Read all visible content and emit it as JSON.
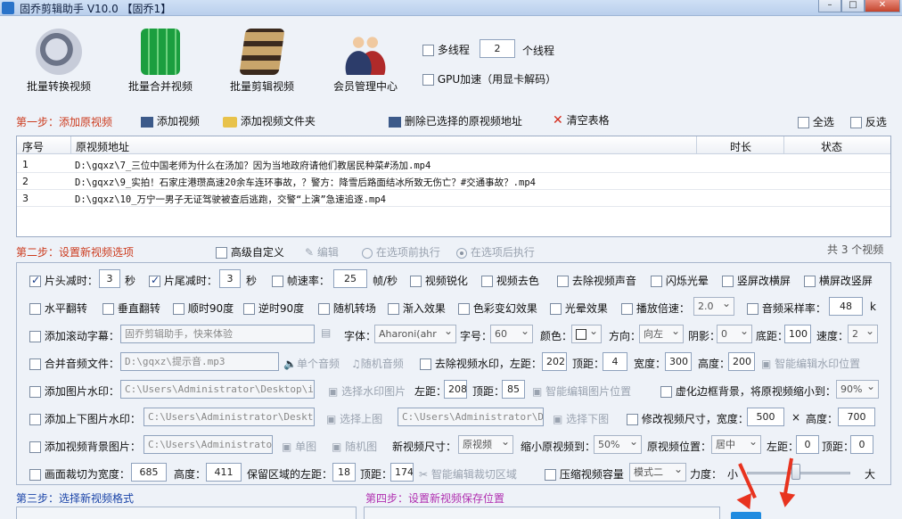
{
  "window": {
    "title": "固乔剪辑助手 V10.0 【固乔1】"
  },
  "toolbar": {
    "batch_convert": "批量转换视频",
    "batch_merge": "批量合并视频",
    "batch_edit": "批量剪辑视频",
    "member_center": "会员管理中心"
  },
  "threads": {
    "multi_label": "多线程",
    "count": "2",
    "unit": "个线程",
    "gpu_label": "GPU加速（用显卡解码）"
  },
  "step1": {
    "label": "第一步：添加原视频",
    "add_video": "添加视频",
    "add_folder": "添加视频文件夹",
    "delete_selected": "删除已选择的原视频地址",
    "clear_table": "清空表格",
    "select_all": "全选",
    "invert": "反选"
  },
  "table": {
    "columns": [
      "序号",
      "原视频地址",
      "时长",
      "状态"
    ],
    "rows": [
      {
        "idx": "1",
        "path": "D:\\gqxz\\7_三位中国老师为什么在汤加？因为当地政府请他们教居民种菜#汤加.mp4"
      },
      {
        "idx": "2",
        "path": "D:\\gqxz\\9_实拍！石家庄港瓒高速20余车连环事故，？警方：降雪后路面结冰所致无伤亡？#交通事故？.mp4"
      },
      {
        "idx": "3",
        "path": "D:\\gqxz\\10_万宁一男子无证驾驶被查后逃跑，交警“上演”急速追逐.mp4"
      }
    ],
    "count_text": "共 3 个视频"
  },
  "step2": {
    "label": "第二步：设置新视频选项",
    "advanced": "高级自定义",
    "edit": "编辑",
    "before_opt": "在选项前执行",
    "after_opt": "在选项后执行"
  },
  "opts": {
    "head_cut": "片头减时：",
    "head_val": "3",
    "sec": "秒",
    "tail_cut": "片尾减时：",
    "tail_val": "3",
    "fps": "帧速率：",
    "fps_val": "25",
    "fps_unit": "帧/秒",
    "sharpen": "视频锐化",
    "decolor": "视频去色",
    "remove_audio": "去除视频声音",
    "flash": "闪烁光晕",
    "v2h": "竖屏改横屏",
    "h2v": "横屏改竖屏",
    "hflip": "水平翻转",
    "vflip": "垂直翻转",
    "rot90": "顺时90度",
    "rotn90": "逆时90度",
    "random_trans": "随机转场",
    "fade_in": "渐入效果",
    "color_change": "色彩变幻效果",
    "halo": "光晕效果",
    "speed_label": "播放倍速：",
    "speed_val": "2.0",
    "sample_label": "音频采样率：",
    "sample_val": "48",
    "sample_unit": "k",
    "scroll_label": "添加滚动字幕：",
    "scroll_val": "固乔剪辑助手，快来体验",
    "font_label": "字体：",
    "font_val": "Aharoni(ahr",
    "size_label": "字号：",
    "size_val": "60",
    "color_label": "颜色：",
    "dir_label": "方向：",
    "dir_val": "向左",
    "shadow_label": "阴影：",
    "shadow_val": "0",
    "bottom_label": "底距：",
    "bottom_val": "100",
    "speed2_label": "速度：",
    "speed2_val": "2",
    "merge_audio": "合并音频文件：",
    "merge_audio_val": "D:\\gqxz\\提示音.mp3",
    "single_audio": "单个音频",
    "random_audio": "随机音频",
    "remove_watermark": "去除视频水印，左距：",
    "wm_left": "202",
    "top_label": "顶距：",
    "wm_top": "4",
    "width_label": "宽度：",
    "wm_width": "300",
    "height_label": "高度：",
    "wm_height": "200",
    "smart_wm": "智能编辑水印位置",
    "img_watermark": "添加图片水印：",
    "img_wm_path": "C:\\Users\\Administrator\\Desktop\\img-q",
    "choose_wm_img": "选择水印图片",
    "left_label": "左距：",
    "img_left": "208",
    "img_top": "85",
    "smart_img": "智能编辑图片位置",
    "blur_bg": "虚化边框背景，将原视频缩小到：",
    "blur_val": "90%",
    "updown_wm": "添加上下图片水印：",
    "up_path": "C:\\Users\\Administrator\\Desktop\\i",
    "choose_up": "选择上图",
    "down_path": "C:\\Users\\Administrator\\Desk",
    "choose_down": "选择下图",
    "resize_label": "修改视频尺寸，宽度：",
    "resize_w": "500",
    "x_sign": "×",
    "resize_h_label": "高度：",
    "resize_h": "700",
    "bg_img": "添加视频背景图片：",
    "bg_path": "C:\\Users\\Administrator\\D",
    "single_img": "单图",
    "random_img": "随机图",
    "new_size": "新视频尺寸：",
    "new_size_val": "原视频",
    "shrink": "缩小原视频到：",
    "shrink_val": "50%",
    "pos_label": "原视频位置：",
    "pos_val": "居中",
    "bg_left": "0",
    "bg_top": "0",
    "crop_label": "画面裁切为宽度：",
    "crop_w": "685",
    "crop_h_label": "高度：",
    "crop_h": "411",
    "keep_left": "保留区域的左距：",
    "keep_left_val": "18",
    "keep_top_label": "顶距：",
    "keep_top_val": "174",
    "smart_crop": "智能编辑裁切区域",
    "compress": "压缩视频容量",
    "mode_val": "模式二",
    "force_label": "力度：",
    "small": "小",
    "big": "大"
  },
  "step3": {
    "label": "第三步：选择新视频格式"
  },
  "step4": {
    "label": "第四步：设置新视频保存位置"
  },
  "colors": {
    "accent": "#cc3b1e",
    "step3": "#1a44a8",
    "step4": "#b02fb0",
    "arrow": "#e8331f"
  }
}
